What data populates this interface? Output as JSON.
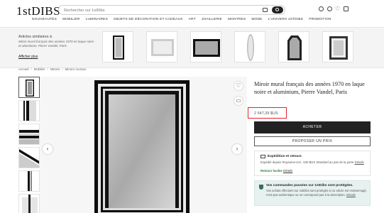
{
  "header": {
    "logo_main": "1stDIBS",
    "search_placeholder": "Rechercher sur 1stDibs"
  },
  "nav": [
    "NOUVEAUTÉS",
    "MOBILIER",
    "LUMINAIRES",
    "OBJETS DE DÉCORATION ET CADEAUX",
    "ART",
    "JOAILLERIE",
    "MONTRES",
    "MODE",
    "L'UNIVERS 1STDIBS",
    "PROMOTION"
  ],
  "similar": {
    "title": "Articles similaires à",
    "desc": "Miroir mural français des années 1970 en laque noire et aluminium, Pierre Vandel, Paris",
    "view_all": "Afficher plus"
  },
  "breadcrumbs": [
    "Accueil",
    "Mobilier",
    "Miroirs",
    "Miroirs muraux"
  ],
  "product": {
    "title": "Miroir mural français des années 1970 en laque noire et aluminium, Pierre Vandel, Paris",
    "price": "2 547,39 $US",
    "buy_label": "ACHETER",
    "offer_label": "PROPOSER UN PRIX"
  },
  "shipping": {
    "title": "Expédition et retours",
    "desc_prefix": "Expédié depuis Royaume-Uni : 630 $US Standard au pas de la porte",
    "details": "Détails",
    "returns_label": "Retours faciles",
    "returns_details": "Détails"
  },
  "protection": {
    "title": "Vos commandes passées sur 1stDibs sont protégées.",
    "desc_a": "Vos achats effectués sur 1stDibs sont protégés si un article est endommagé, n'est pas authentique ou ne correspond pas à la description.",
    "details": "Détails"
  },
  "colors": {
    "accent_red": "#e5222b",
    "dark": "#222222",
    "protect_bg": "#e7f2f0"
  }
}
